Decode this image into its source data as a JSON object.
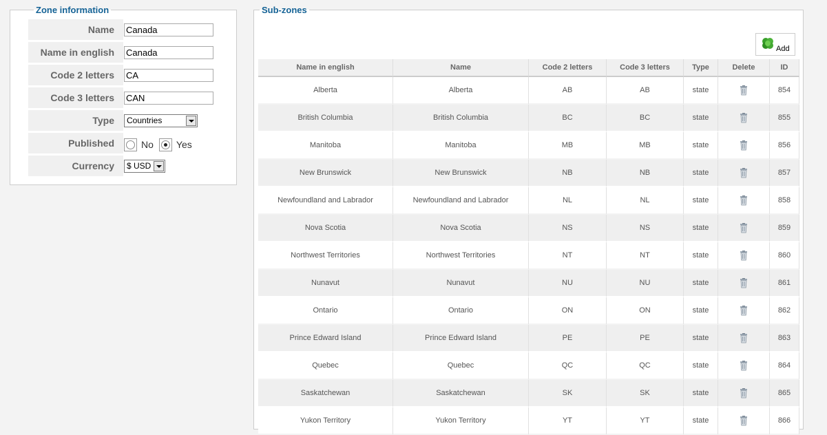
{
  "zone_info": {
    "legend": "Zone information",
    "fields": {
      "name": {
        "label": "Name",
        "value": "Canada"
      },
      "name_english": {
        "label": "Name in english",
        "value": "Canada"
      },
      "code2": {
        "label": "Code 2 letters",
        "value": "CA"
      },
      "code3": {
        "label": "Code 3 letters",
        "value": "CAN"
      },
      "type": {
        "label": "Type",
        "value": "Countries"
      },
      "published": {
        "label": "Published",
        "options": [
          "No",
          "Yes"
        ],
        "selected": "Yes"
      },
      "currency": {
        "label": "Currency",
        "value": "$ USD"
      }
    }
  },
  "subzones": {
    "legend": "Sub-zones",
    "add_label": "Add",
    "add_icon": "green-plus-icon",
    "delete_icon": "trash-icon",
    "columns": [
      "Name in english",
      "Name",
      "Code 2 letters",
      "Code 3 letters",
      "Type",
      "Delete",
      "ID"
    ],
    "rows": [
      {
        "name_english": "Alberta",
        "name": "Alberta",
        "code2": "AB",
        "code3": "AB",
        "type": "state",
        "id": "854"
      },
      {
        "name_english": "British Columbia",
        "name": "British Columbia",
        "code2": "BC",
        "code3": "BC",
        "type": "state",
        "id": "855"
      },
      {
        "name_english": "Manitoba",
        "name": "Manitoba",
        "code2": "MB",
        "code3": "MB",
        "type": "state",
        "id": "856"
      },
      {
        "name_english": "New Brunswick",
        "name": "New Brunswick",
        "code2": "NB",
        "code3": "NB",
        "type": "state",
        "id": "857"
      },
      {
        "name_english": "Newfoundland and Labrador",
        "name": "Newfoundland and Labrador",
        "code2": "NL",
        "code3": "NL",
        "type": "state",
        "id": "858"
      },
      {
        "name_english": "Nova Scotia",
        "name": "Nova Scotia",
        "code2": "NS",
        "code3": "NS",
        "type": "state",
        "id": "859"
      },
      {
        "name_english": "Northwest Territories",
        "name": "Northwest Territories",
        "code2": "NT",
        "code3": "NT",
        "type": "state",
        "id": "860"
      },
      {
        "name_english": "Nunavut",
        "name": "Nunavut",
        "code2": "NU",
        "code3": "NU",
        "type": "state",
        "id": "861"
      },
      {
        "name_english": "Ontario",
        "name": "Ontario",
        "code2": "ON",
        "code3": "ON",
        "type": "state",
        "id": "862"
      },
      {
        "name_english": "Prince Edward Island",
        "name": "Prince Edward Island",
        "code2": "PE",
        "code3": "PE",
        "type": "state",
        "id": "863"
      },
      {
        "name_english": "Quebec",
        "name": "Quebec",
        "code2": "QC",
        "code3": "QC",
        "type": "state",
        "id": "864"
      },
      {
        "name_english": "Saskatchewan",
        "name": "Saskatchewan",
        "code2": "SK",
        "code3": "SK",
        "type": "state",
        "id": "865"
      },
      {
        "name_english": "Yukon Territory",
        "name": "Yukon Territory",
        "code2": "YT",
        "code3": "YT",
        "type": "state",
        "id": "866"
      }
    ]
  }
}
